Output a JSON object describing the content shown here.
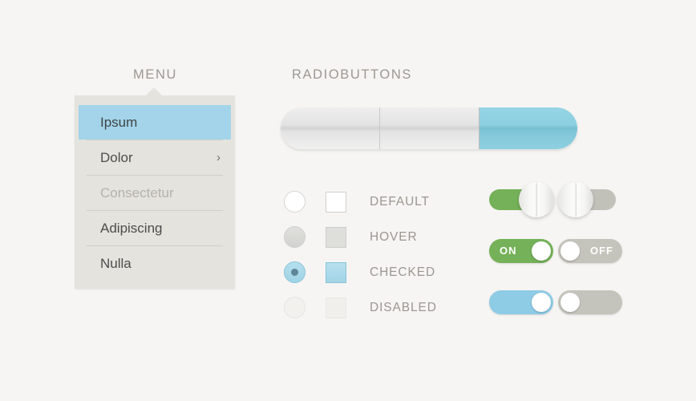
{
  "sections": {
    "menu_title": "MENU",
    "radio_title": "RADIOBUTTONS"
  },
  "menu": {
    "items": [
      {
        "label": "Ipsum",
        "state": "selected"
      },
      {
        "label": "Dolor",
        "state": "default",
        "chevron": "›"
      },
      {
        "label": "Consectetur",
        "state": "disabled"
      },
      {
        "label": "Adipiscing",
        "state": "default"
      },
      {
        "label": "Nulla",
        "state": "default"
      }
    ]
  },
  "segmented": {
    "segments": [
      {
        "label": "",
        "active": false
      },
      {
        "label": "",
        "active": false
      },
      {
        "label": "",
        "active": true
      }
    ]
  },
  "controls": {
    "rows": [
      {
        "label": "DEFAULT",
        "state": "default"
      },
      {
        "label": "HOVER",
        "state": "hover"
      },
      {
        "label": "CHECKED",
        "state": "checked"
      },
      {
        "label": "DISABLED",
        "state": "disabled"
      }
    ]
  },
  "toggles": {
    "row1": [
      {
        "state": "on",
        "color": "green",
        "label": ""
      },
      {
        "state": "off",
        "color": "grey",
        "label": ""
      }
    ],
    "row2": [
      {
        "state": "on",
        "color": "green",
        "label": "ON"
      },
      {
        "state": "off",
        "color": "grey",
        "label": "OFF"
      }
    ],
    "row3": [
      {
        "state": "on",
        "color": "blue",
        "label": ""
      },
      {
        "state": "off",
        "color": "grey",
        "label": ""
      }
    ]
  },
  "colors": {
    "background": "#f6f5f3",
    "accent_blue": "#a3d4ea",
    "accent_green": "#74b158",
    "panel": "#e4e3dd",
    "text": "#4c4c4c",
    "muted": "#9b9791"
  }
}
